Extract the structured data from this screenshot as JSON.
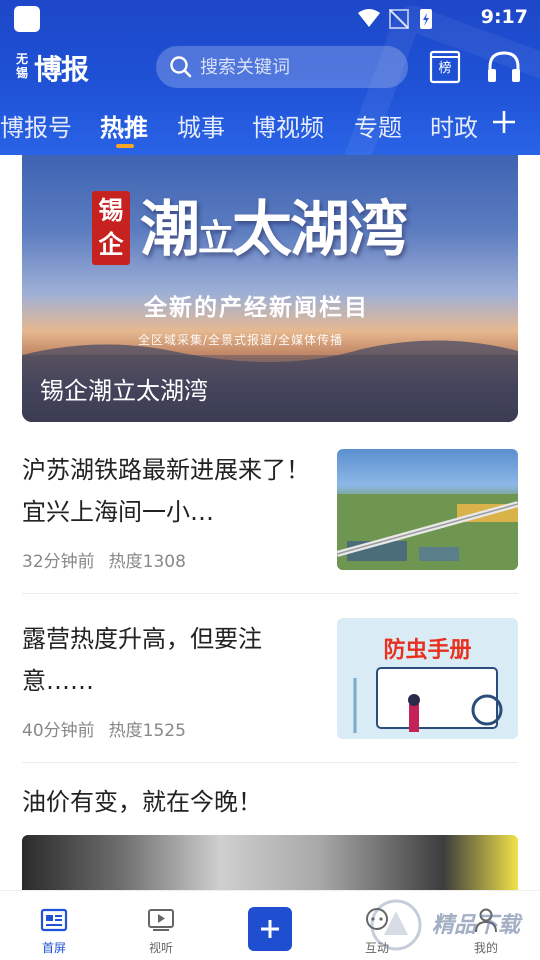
{
  "status_bar": {
    "time": "9:17"
  },
  "header": {
    "logo_small": "无锡",
    "logo_big": "博报",
    "search": {
      "placeholder": "搜索关键词"
    },
    "rank_label": "榜"
  },
  "tabs": [
    {
      "label": "博报号",
      "active": false
    },
    {
      "label": "热推",
      "active": true
    },
    {
      "label": "城事",
      "active": false
    },
    {
      "label": "博视频",
      "active": false
    },
    {
      "label": "专题",
      "active": false
    },
    {
      "label": "时政",
      "active": false
    }
  ],
  "banner": {
    "seal": "锡企",
    "title_a": "潮",
    "title_b": "立",
    "title_c": "太湖湾",
    "subtitle": "全新的产经新闻栏目",
    "tagline": "全区域采集/全景式报道/全媒体传播",
    "caption": "锡企潮立太湖湾"
  },
  "articles": [
    {
      "title": "沪苏湖铁路最新进展来了！宜兴上海间一小…",
      "time": "32分钟前",
      "heat": "热度1308"
    },
    {
      "title": "露营热度升高，但要注意……",
      "time": "40分钟前",
      "heat": "热度1525",
      "thumb_text": "防虫手册"
    },
    {
      "title": "油价有变，就在今晚！"
    }
  ],
  "bottom_nav": [
    {
      "label": "首屏",
      "icon": "news-icon",
      "active": true
    },
    {
      "label": "视听",
      "icon": "video-icon",
      "active": false
    },
    {
      "label": "互动",
      "icon": "interact-icon",
      "active": false
    },
    {
      "label": "我的",
      "icon": "user-icon",
      "active": false
    }
  ],
  "watermark": "精品下载",
  "colors": {
    "primary": "#1f52d6",
    "accent": "#f5a623",
    "seal_red": "#c52220"
  }
}
